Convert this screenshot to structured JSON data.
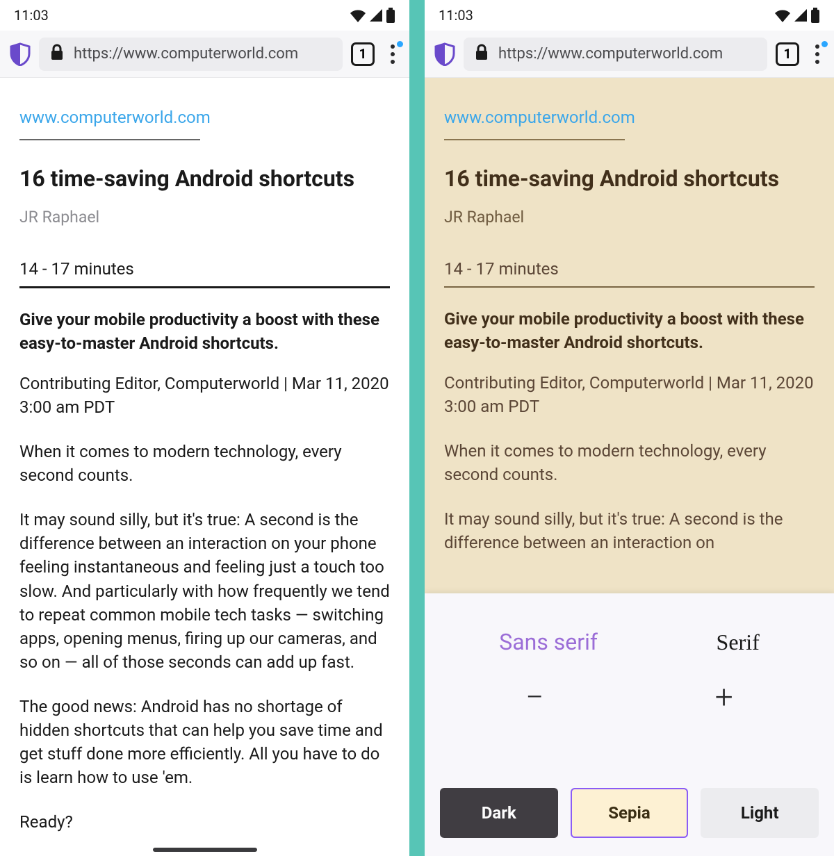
{
  "statusbar": {
    "time": "11:03"
  },
  "browser": {
    "url": "https://www.computerworld.com",
    "tab_count": "1"
  },
  "article": {
    "site": "www.computerworld.com",
    "title": "16 time-saving Android shortcuts",
    "author": "JR Raphael",
    "read_time": "14 - 17 minutes",
    "subhead": "Give your mobile productivity a boost with these easy-to-master Android shortcuts.",
    "meta": "Contributing Editor, Computerworld | Mar 11, 2020 3:00 am PDT",
    "p1": "When it comes to modern technology, every second counts.",
    "p2": "It may sound silly, but it's true: A second is the difference between an interaction on your phone feeling instantaneous and feeling just a touch too slow. And particularly with how frequently we tend to repeat common mobile tech tasks — switching apps, opening menus, firing up our cameras, and so on — all of those seconds can add up fast.",
    "p2_short": "It may sound silly, but it's true: A second is the difference between an interaction on",
    "p3": "The good news: Android has no shortage of hidden shortcuts that can help you save time and get stuff done more efficiently. All you have to do is learn how to use 'em.",
    "p4": "Ready?"
  },
  "controls": {
    "font_sans": "Sans serif",
    "font_serif": "Serif",
    "minus": "−",
    "plus": "+",
    "themes": {
      "dark": "Dark",
      "sepia": "Sepia",
      "light": "Light"
    }
  }
}
